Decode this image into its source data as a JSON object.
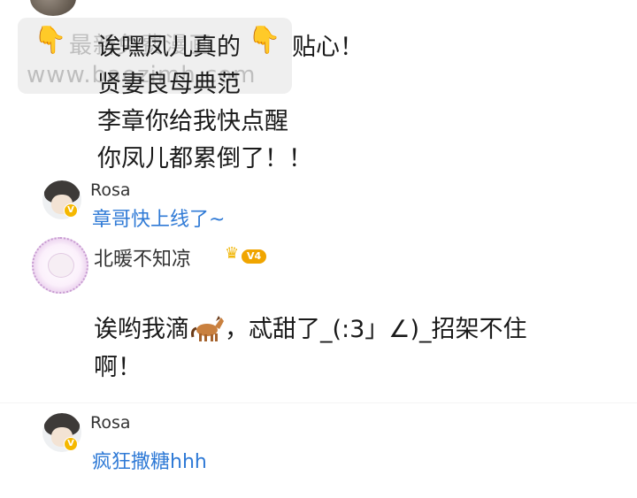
{
  "watermark": {
    "line1": "最新免费漫画",
    "line2": "www.baozimh.com"
  },
  "post": {
    "line1_a": "诶嘿凤儿真的",
    "line1_b": "贴心！",
    "line2": "贤妻良母典范",
    "line3": "李章你给我快点醒",
    "line4": "你凤儿都累倒了！！",
    "hand_icon": "👇"
  },
  "comments": [
    {
      "name": "Rosa",
      "badge": "V",
      "text": "章哥快上线了~"
    },
    {
      "name": "北暖不知凉",
      "level": "V4",
      "text_a": "诶哟我滴",
      "text_b": "，忒甜了_(:3」∠)_招架不住",
      "text_line2": "啊！"
    },
    {
      "name": "Rosa",
      "badge": "V",
      "text": "疯狂撒糖hhh"
    }
  ],
  "colors": {
    "link_blue": "#2f7ad6",
    "badge_gold": "#f5b800"
  }
}
